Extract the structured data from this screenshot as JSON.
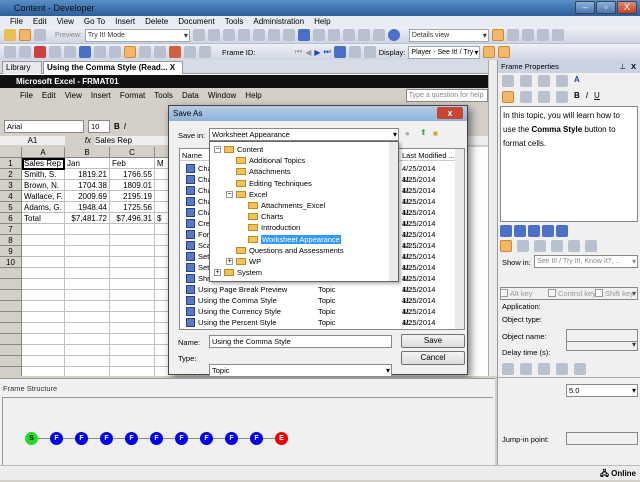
{
  "app": {
    "title": "Content - Developer",
    "min": "–",
    "max": "▫",
    "close": "X"
  },
  "menu": [
    "File",
    "Edit",
    "View",
    "Go To",
    "Insert",
    "Delete",
    "Document",
    "Tools",
    "Administration",
    "Help"
  ],
  "toolbar": {
    "preview_label": "Preview:",
    "preview_mode": "Try It! Mode",
    "view_mode": "Details view",
    "frame_id_label": "Frame ID:",
    "display_label": "Display:",
    "display_value": "Player - See It! / Try It!"
  },
  "tabs": [
    {
      "label": "Library"
    },
    {
      "label": "Using the Comma Style (Read...",
      "close": "X"
    }
  ],
  "excel": {
    "title": "Microsoft Excel - FRMAT01",
    "menu": [
      "File",
      "Edit",
      "View",
      "Insert",
      "Format",
      "Tools",
      "Data",
      "Window",
      "Help"
    ],
    "help_placeholder": "Type a question for help",
    "font": "Arial",
    "size": "10",
    "namebox": "A1",
    "fx": "fx",
    "formula": "Sales Rep",
    "columns": [
      "A",
      "B",
      "C",
      "D"
    ],
    "rows": [
      [
        "1",
        "Sales Rep",
        "Jan",
        "Feb",
        "M"
      ],
      [
        "2",
        "Smith, S.",
        "1819.21",
        "1766.55",
        ""
      ],
      [
        "3",
        "Brown, N.",
        "1704.38",
        "1809.01",
        ""
      ],
      [
        "4",
        "Wallace, F.",
        "2009.69",
        "2195.19",
        ""
      ],
      [
        "5",
        "Adams, G.",
        "1948.44",
        "1725.56",
        ""
      ],
      [
        "6",
        "Total",
        "$7,481.72",
        "$7,496.31",
        "$"
      ],
      [
        "7",
        "",
        "",
        "",
        ""
      ],
      [
        "8",
        "",
        "",
        "",
        ""
      ],
      [
        "9",
        "",
        "",
        "",
        ""
      ],
      [
        "10",
        "",
        "",
        "",
        ""
      ]
    ]
  },
  "dialog": {
    "title": "Save As",
    "close": "x",
    "save_in_label": "Save in:",
    "save_in_value": "Worksheet Appearance",
    "col_name": "Name",
    "col_modified": "Last Modified ...",
    "files": [
      {
        "name": "Cha",
        "type": "",
        "date": "4/25/2014 11:..."
      },
      {
        "name": "Cha",
        "type": "",
        "date": "4/25/2014 11:..."
      },
      {
        "name": "Cha",
        "type": "",
        "date": "4/25/2014 11:..."
      },
      {
        "name": "Cha",
        "type": "",
        "date": "4/25/2014 11:..."
      },
      {
        "name": "Cha",
        "type": "",
        "date": "4/25/2014 11:..."
      },
      {
        "name": "Cre",
        "type": "",
        "date": "4/25/2014 11:..."
      },
      {
        "name": "Form",
        "type": "",
        "date": "4/25/2014 12:..."
      },
      {
        "name": "Scal",
        "type": "",
        "date": "4/25/2014 11:..."
      },
      {
        "name": "Sett",
        "type": "",
        "date": "4/25/2014 11:..."
      },
      {
        "name": "Sett",
        "type": "",
        "date": "4/25/2014 11:..."
      },
      {
        "name": "Shri",
        "type": "",
        "date": "4/25/2014 11:..."
      },
      {
        "name": "Using Page Break Preview",
        "type": "Topic",
        "date": "4/25/2014 11:..."
      },
      {
        "name": "Using the Comma Style",
        "type": "Topic",
        "date": "4/25/2014 11:..."
      },
      {
        "name": "Using the Currency Style",
        "type": "Topic",
        "date": "4/25/2014 11:..."
      },
      {
        "name": "Using the Percent Style",
        "type": "Topic",
        "date": "4/25/2014 11:..."
      }
    ],
    "tree": [
      {
        "label": "Content",
        "level": 0,
        "exp": "−"
      },
      {
        "label": "Additional Topics",
        "level": 1
      },
      {
        "label": "Attachments",
        "level": 1
      },
      {
        "label": "Editing Techniques",
        "level": 1
      },
      {
        "label": "Excel",
        "level": 1,
        "exp": "−"
      },
      {
        "label": "Attachments_Excel",
        "level": 2
      },
      {
        "label": "Charts",
        "level": 2
      },
      {
        "label": "Introduction",
        "level": 2
      },
      {
        "label": "Worksheet Appearance",
        "level": 2,
        "selected": true
      },
      {
        "label": "Questions and Assessments",
        "level": 1
      },
      {
        "label": "WP",
        "level": 1,
        "exp": "+"
      },
      {
        "label": "System",
        "level": 0,
        "exp": "+"
      }
    ],
    "name_label": "Name:",
    "name_value": "Using the Comma Style",
    "type_label": "Type:",
    "type_value": "Topic",
    "save": "Save",
    "cancel": "Cancel"
  },
  "props": {
    "title": "Frame Properties",
    "pin": "⊥",
    "close": "X",
    "text_plain1": "In this topic, you will learn how to use the ",
    "text_bold": "Comma Style",
    "text_plain2": " button to format cells.",
    "show_in_label": "Show in:",
    "show_in_value": "See It! / Try It!, Know It?, ...",
    "alt": "Alt key",
    "ctrl": "Control key",
    "shift": "Shift key",
    "application": "Application:",
    "object_type": "Object type:",
    "object_name": "Object name:",
    "delay_label": "Delay time (s):",
    "delay_value": "5.0",
    "jump_label": "Jump-in point:"
  },
  "frames": {
    "title": "Frame Structure",
    "nodes": [
      "S",
      "F",
      "F",
      "F",
      "F",
      "F",
      "F",
      "F",
      "F",
      "F",
      "E"
    ],
    "colors": {
      "S": "#22dd22",
      "F": "#0000ee",
      "E": "#ee0000"
    }
  },
  "status": {
    "online": "Online"
  }
}
